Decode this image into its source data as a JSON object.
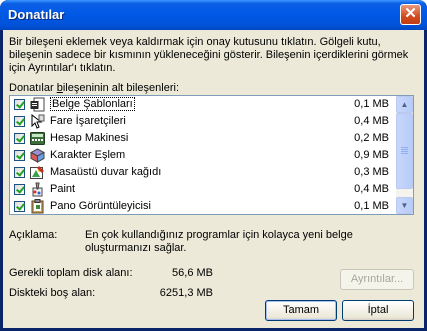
{
  "window": {
    "title": "Donatılar",
    "close_glyph": "✕"
  },
  "description": "Bir bileşeni eklemek veya kaldırmak için onay kutusunu tıklatın. Gölgeli kutu, bileşenin sadece bir kısmının yükleneceğini gösterir. Bileşenin içerdiklerini görmek için Ayrıntılar'ı tıklatın.",
  "list_label_prefix": "Donatılar ",
  "list_label_underlined": "b",
  "list_label_suffix": "ileşeninin alt bileşenleri:",
  "components": [
    {
      "name": "Belge Şablonları",
      "size": "0,1 MB",
      "checked": true,
      "selected": true,
      "icon": "document-template-icon"
    },
    {
      "name": "Fare İşaretçileri",
      "size": "0,4 MB",
      "checked": true,
      "icon": "mouse-pointer-icon"
    },
    {
      "name": "Hesap Makinesi",
      "size": "0,2 MB",
      "checked": true,
      "icon": "calculator-icon"
    },
    {
      "name": "Karakter Eşlem",
      "size": "0,9 MB",
      "checked": true,
      "icon": "character-map-icon"
    },
    {
      "name": "Masaüstü duvar kağıdı",
      "size": "0,3 MB",
      "checked": true,
      "icon": "wallpaper-icon"
    },
    {
      "name": "Paint",
      "size": "0,4 MB",
      "checked": true,
      "icon": "paint-icon"
    },
    {
      "name": "Pano Görüntüleyicisi",
      "size": "0,1 MB",
      "checked": true,
      "icon": "clipboard-viewer-icon"
    }
  ],
  "info": {
    "label": "Açıklama:",
    "text": "En çok kullandığınız programlar için kolayca yeni belge oluşturmanızı sağlar."
  },
  "disk": {
    "required_label": "Gerekli toplam disk alanı:",
    "required_value": "56,6 MB",
    "free_label": "Diskteki boş alan:",
    "free_value": "6251,3 MB"
  },
  "buttons": {
    "details": "Ayrıntılar...",
    "ok": "Tamam",
    "cancel": "İptal"
  }
}
